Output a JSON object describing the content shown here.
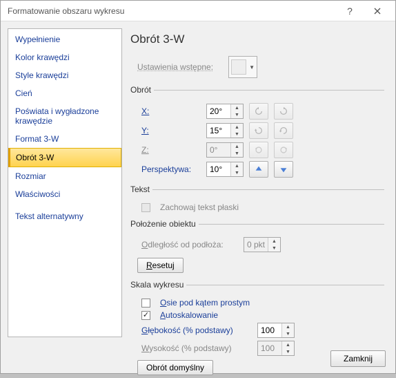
{
  "window": {
    "title": "Formatowanie obszaru wykresu",
    "close_label": "Zamknij"
  },
  "sidebar": {
    "items": [
      {
        "label": "Wypełnienie"
      },
      {
        "label": "Kolor krawędzi"
      },
      {
        "label": "Style krawędzi"
      },
      {
        "label": "Cień"
      },
      {
        "label": "Poświata i wygładzone krawędzie"
      },
      {
        "label": "Format 3-W"
      },
      {
        "label": "Obrót 3-W"
      },
      {
        "label": "Rozmiar"
      },
      {
        "label": "Właściwości"
      },
      {
        "label": "Tekst alternatywny"
      }
    ],
    "selected_index": 6
  },
  "panel": {
    "title": "Obrót 3-W",
    "presets_label": "Ustawienia wstępne:",
    "groups": {
      "rotation": {
        "legend": "Obrót",
        "x_label": "X:",
        "x_value": "20°",
        "y_label": "Y:",
        "y_value": "15°",
        "z_label": "Z:",
        "z_value": "0°",
        "z_enabled": false,
        "perspective_label": "Perspektywa:",
        "perspective_value": "10°"
      },
      "text": {
        "legend": "Tekst",
        "keep_flat_label": "Zachowaj tekst płaski",
        "keep_flat_enabled": false,
        "keep_flat_checked": false
      },
      "position": {
        "legend": "Położenie obiektu",
        "distance_label": "Odległość od podłoża:",
        "distance_value": "0 pkt",
        "distance_enabled": false,
        "reset_label": "Resetuj"
      },
      "scale": {
        "legend": "Skala wykresu",
        "right_angle_label": "Osie pod kątem prostym",
        "right_angle_checked": false,
        "autoscale_label": "Autoskalowanie",
        "autoscale_checked": true,
        "depth_label": "Głębokość (% podstawy)",
        "depth_value": "100",
        "height_label": "Wysokość (% podstawy)",
        "height_value": "100",
        "height_enabled": false,
        "default_rotation_label": "Obrót domyślny"
      }
    }
  }
}
